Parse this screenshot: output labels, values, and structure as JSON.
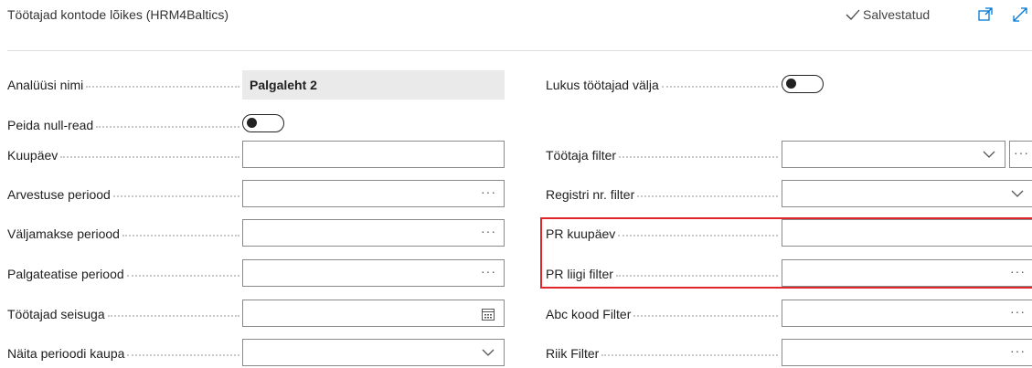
{
  "header": {
    "title": "Töötajad kontode lõikes (HRM4Baltics)",
    "saved_label": "Salvestatud",
    "icons": [
      "check-icon",
      "open-new-window-icon",
      "expand-icon"
    ]
  },
  "left": {
    "analysis_name": {
      "label": "Analüüsi nimi",
      "value": "Palgaleht 2"
    },
    "hide_null_rows": {
      "label": "Peida null-read",
      "state": "off"
    },
    "date": {
      "label": "Kuupäev",
      "value": ""
    },
    "accounting_period": {
      "label": "Arvestuse periood",
      "value": "",
      "assist": "···"
    },
    "payment_period": {
      "label": "Väljamakse periood",
      "value": "",
      "assist": "···"
    },
    "payslip_period": {
      "label": "Palgateatise periood",
      "value": "",
      "assist": "···"
    },
    "employees_as_of": {
      "label": "Töötajad seisuga",
      "value": ""
    },
    "show_by_period": {
      "label": "Näita perioodi kaupa",
      "value": ""
    }
  },
  "right": {
    "lock_employees": {
      "label": "Lukus töötajad välja",
      "state": "off"
    },
    "employee_filter": {
      "label": "Töötaja filter",
      "value": "",
      "assist": "···"
    },
    "register_filter": {
      "label": "Registri nr. filter",
      "value": ""
    },
    "pr_date": {
      "label": "PR kuupäev",
      "value": ""
    },
    "pr_type_filter": {
      "label": "PR liigi filter",
      "value": "",
      "assist": "···"
    },
    "abc_code_filter": {
      "label": "Abc kood Filter",
      "value": "",
      "assist": "···"
    },
    "country_filter": {
      "label": "Riik Filter",
      "value": "",
      "assist": "···"
    }
  },
  "colors": {
    "highlight": "#e0262b",
    "readonly_bg": "#eaeaea",
    "accent": "#0078d4"
  }
}
